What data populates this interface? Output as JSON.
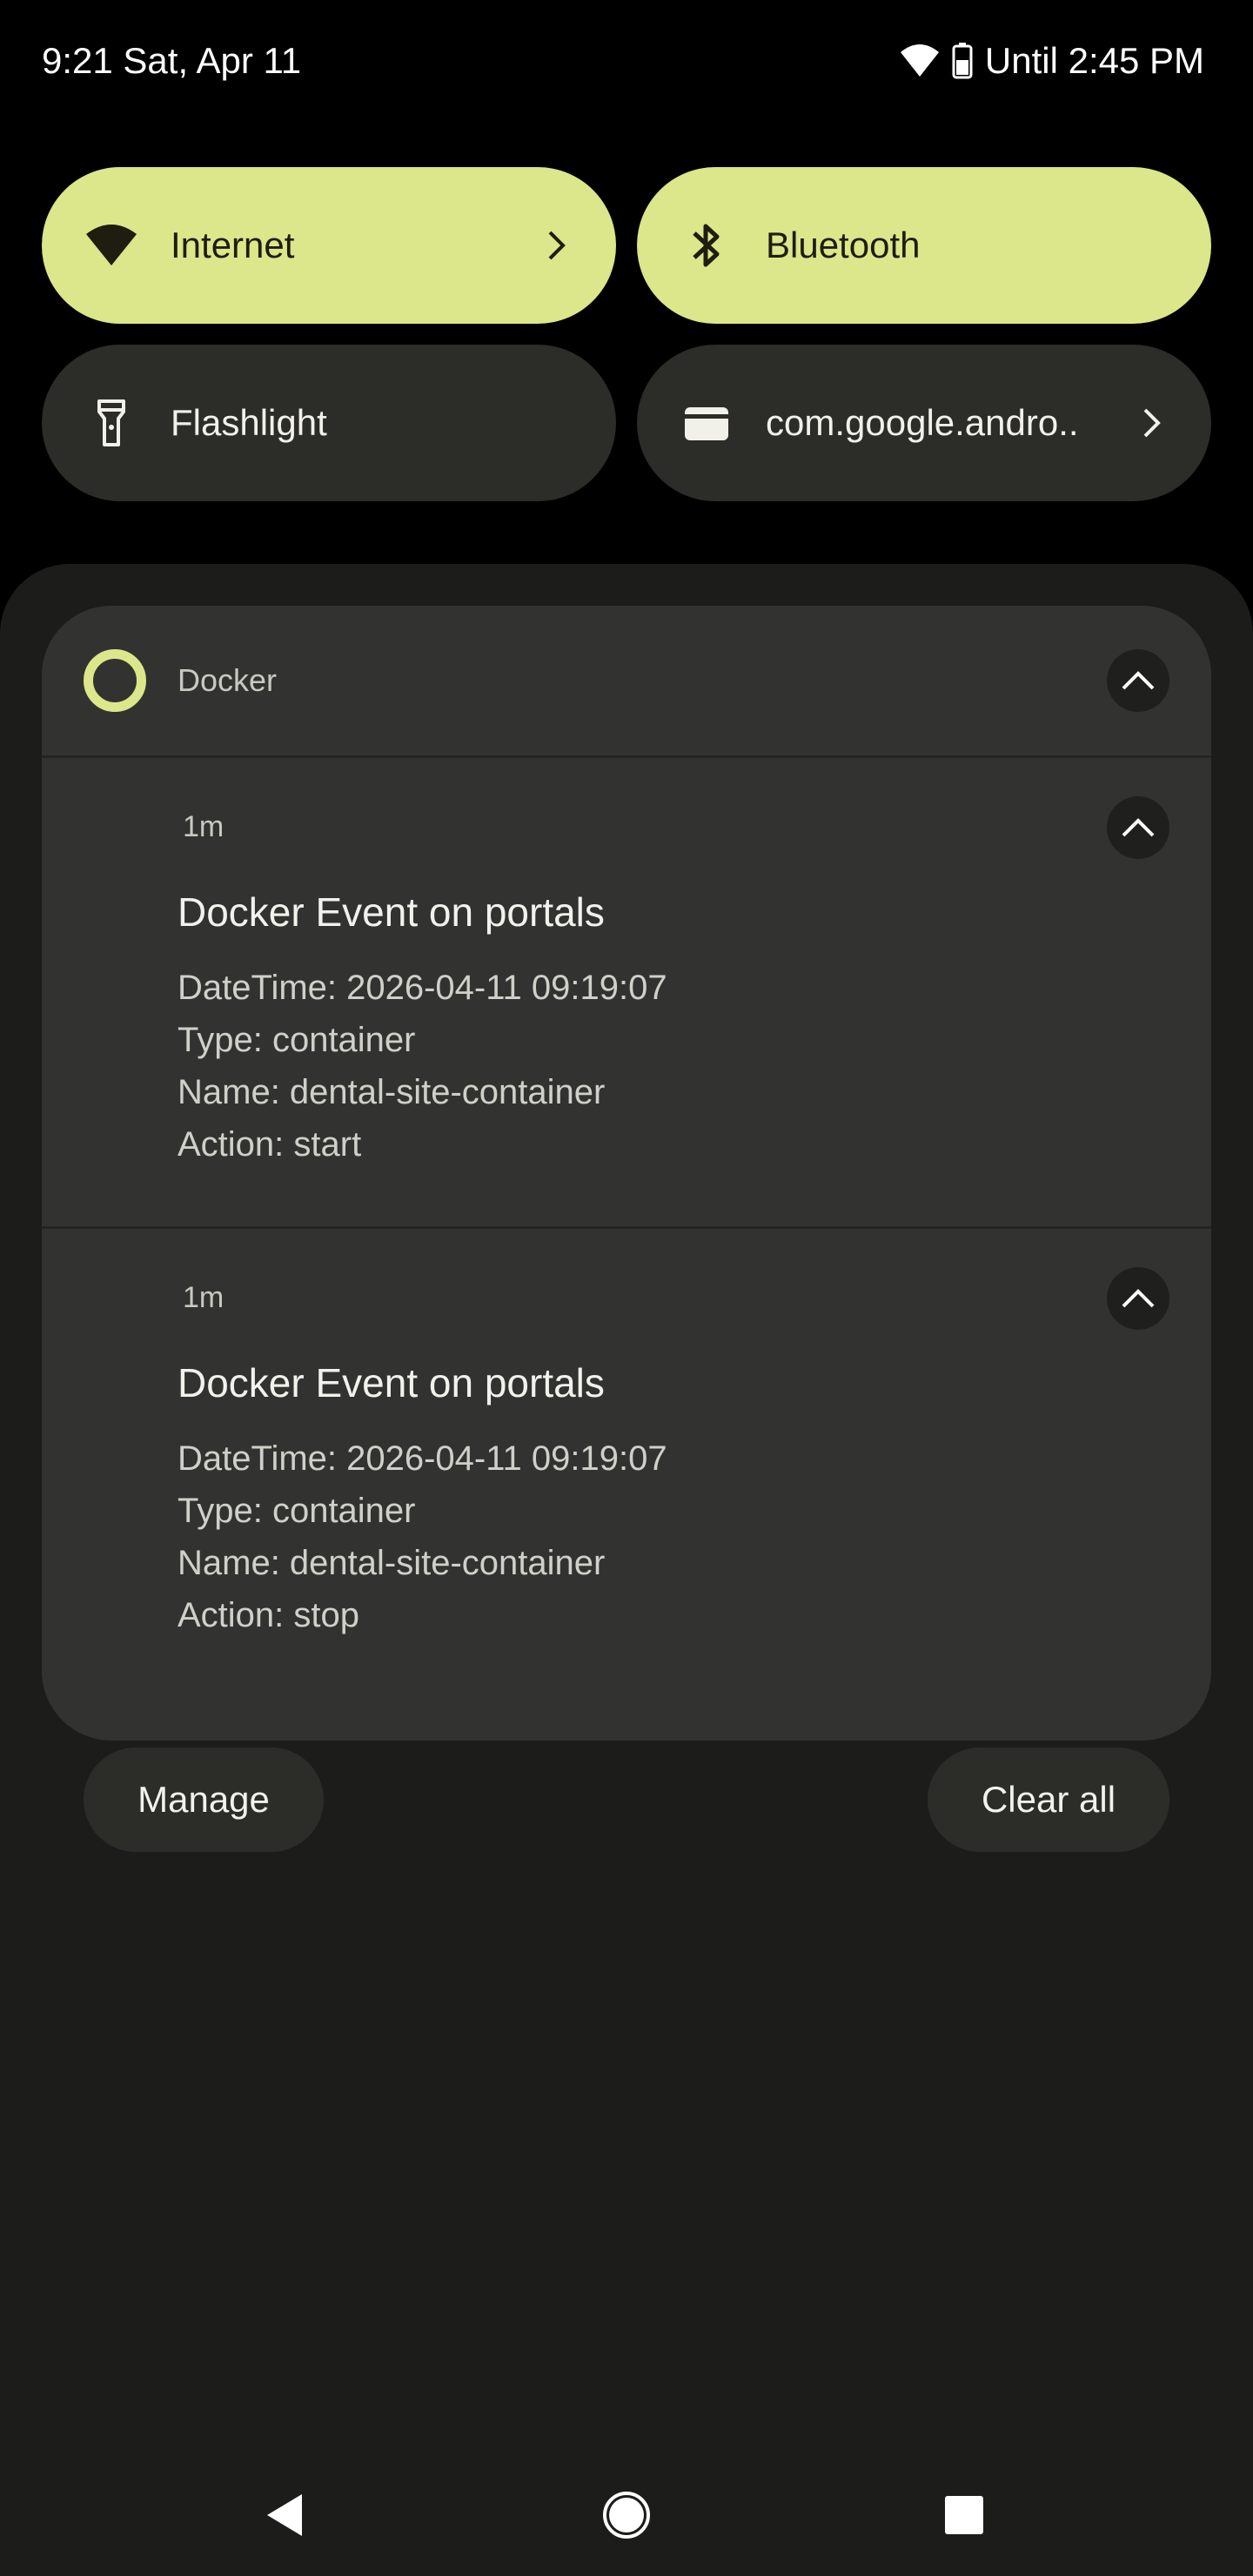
{
  "status_bar": {
    "datetime": "9:21 Sat, Apr 11",
    "battery_text": "Until 2:45 PM",
    "icons": [
      "wifi-icon",
      "battery-icon"
    ]
  },
  "quick_settings": [
    {
      "label": "Internet",
      "state": "on",
      "icon": "wifi-icon",
      "has_chevron": true
    },
    {
      "label": "Bluetooth",
      "state": "on",
      "icon": "bluetooth-icon",
      "has_chevron": false
    },
    {
      "label": "Flashlight",
      "state": "off",
      "icon": "flashlight-icon",
      "has_chevron": false
    },
    {
      "label": "com.google.andro..",
      "state": "off",
      "icon": "wallet-icon",
      "has_chevron": true
    }
  ],
  "notification_group": {
    "app_name": "Docker",
    "notifications": [
      {
        "time": "1m",
        "title": "Docker Event on portals",
        "lines": [
          "DateTime: 2026-04-11 09:19:07",
          "Type: container",
          "Name: dental-site-container",
          "Action: start"
        ]
      },
      {
        "time": "1m",
        "title": "Docker Event on portals",
        "lines": [
          "DateTime: 2026-04-11 09:19:07",
          "Type: container",
          "Name: dental-site-container",
          "Action: stop"
        ]
      }
    ]
  },
  "actions": {
    "manage": "Manage",
    "clear_all": "Clear all"
  },
  "navigation": [
    "back-icon",
    "home-icon",
    "recents-icon"
  ],
  "colors": {
    "accent": "#dce68a",
    "shade": "#1c1c1a",
    "card": "#323330",
    "tile_off": "#2c2d29"
  }
}
